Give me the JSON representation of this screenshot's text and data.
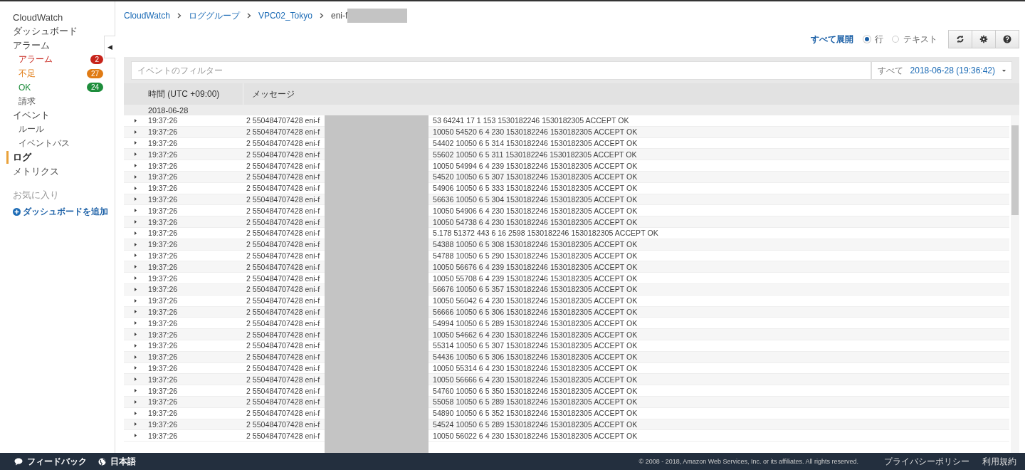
{
  "sidebar": {
    "items": [
      {
        "kind": "section",
        "label": "CloudWatch",
        "selected": false
      },
      {
        "kind": "section",
        "label": "ダッシュボード",
        "selected": false
      },
      {
        "kind": "section",
        "label": "アラーム",
        "selected": false
      },
      {
        "kind": "sub",
        "label": "アラーム",
        "selected": false,
        "badge": "2",
        "color": "#c7241b"
      },
      {
        "kind": "sub",
        "label": "不足",
        "selected": false,
        "badge": "27",
        "color": "#e07b14"
      },
      {
        "kind": "sub",
        "label": "OK",
        "selected": false,
        "badge": "24",
        "color": "#1e8d3c"
      },
      {
        "kind": "sub",
        "label": "請求",
        "selected": false
      },
      {
        "kind": "section",
        "label": "イベント",
        "selected": false
      },
      {
        "kind": "sub",
        "label": "ルール",
        "selected": false
      },
      {
        "kind": "sub",
        "label": "イベントバス",
        "selected": false
      },
      {
        "kind": "section",
        "label": "ログ",
        "selected": true
      },
      {
        "kind": "section",
        "label": "メトリクス",
        "selected": false
      },
      {
        "kind": "heading",
        "label": "お気に入り",
        "selected": false
      },
      {
        "kind": "link",
        "label": "ダッシュボードを追加",
        "selected": false
      }
    ],
    "collapse": "◀"
  },
  "breadcrumb": [
    "CloudWatch",
    "ロググループ",
    "VPC02_Tokyo",
    "eni-f"
  ],
  "toolbar": {
    "expand_all": "すべて展開",
    "view": [
      {
        "label": "行",
        "selected": true
      },
      {
        "label": "テキスト",
        "selected": false
      }
    ]
  },
  "filter": {
    "placeholder": "イベントのフィルター",
    "range_label": "すべて",
    "range_value": "2018-06-28 (19:36:42)"
  },
  "table": {
    "columns": [
      "時間 (UTC +09:00)",
      "メッセージ"
    ],
    "date": "2018-06-28",
    "rows": [
      {
        "time": "19:37:26",
        "message_start": "2 550484707428 eni-f",
        "message_end": "53 64241 17 1 153 1530182246 1530182305 ACCEPT OK"
      },
      {
        "time": "19:37:26",
        "message_start": "2 550484707428 eni-f",
        "message_end": "10050 54520 6 4 230 1530182246 1530182305 ACCEPT OK"
      },
      {
        "time": "19:37:26",
        "message_start": "2 550484707428 eni-f",
        "message_end": "54402 10050 6 5 314 1530182246 1530182305 ACCEPT OK"
      },
      {
        "time": "19:37:26",
        "message_start": "2 550484707428 eni-f",
        "message_end": "55602 10050 6 5 311 1530182246 1530182305 ACCEPT OK"
      },
      {
        "time": "19:37:26",
        "message_start": "2 550484707428 eni-f",
        "message_end": "10050 54994 6 4 239 1530182246 1530182305 ACCEPT OK"
      },
      {
        "time": "19:37:26",
        "message_start": "2 550484707428 eni-f",
        "message_end": "54520 10050 6 5 307 1530182246 1530182305 ACCEPT OK"
      },
      {
        "time": "19:37:26",
        "message_start": "2 550484707428 eni-f",
        "message_end": "54906 10050 6 5 333 1530182246 1530182305 ACCEPT OK"
      },
      {
        "time": "19:37:26",
        "message_start": "2 550484707428 eni-f",
        "message_end": "56636 10050 6 5 304 1530182246 1530182305 ACCEPT OK"
      },
      {
        "time": "19:37:26",
        "message_start": "2 550484707428 eni-f",
        "message_end": "10050 54906 6 4 230 1530182246 1530182305 ACCEPT OK"
      },
      {
        "time": "19:37:26",
        "message_start": "2 550484707428 eni-f",
        "message_end": "10050 54738 6 4 230 1530182246 1530182305 ACCEPT OK"
      },
      {
        "time": "19:37:26",
        "message_start": "2 550484707428 eni-f",
        "message_end": "5.178 51372 443 6 16 2598 1530182246 1530182305 ACCEPT OK"
      },
      {
        "time": "19:37:26",
        "message_start": "2 550484707428 eni-f",
        "message_end": "54388 10050 6 5 308 1530182246 1530182305 ACCEPT OK"
      },
      {
        "time": "19:37:26",
        "message_start": "2 550484707428 eni-f",
        "message_end": "54788 10050 6 5 290 1530182246 1530182305 ACCEPT OK"
      },
      {
        "time": "19:37:26",
        "message_start": "2 550484707428 eni-f",
        "message_end": "10050 56676 6 4 239 1530182246 1530182305 ACCEPT OK"
      },
      {
        "time": "19:37:26",
        "message_start": "2 550484707428 eni-f",
        "message_end": "10050 55708 6 4 239 1530182246 1530182305 ACCEPT OK"
      },
      {
        "time": "19:37:26",
        "message_start": "2 550484707428 eni-f",
        "message_end": "56676 10050 6 5 357 1530182246 1530182305 ACCEPT OK"
      },
      {
        "time": "19:37:26",
        "message_start": "2 550484707428 eni-f",
        "message_end": "10050 56042 6 4 230 1530182246 1530182305 ACCEPT OK"
      },
      {
        "time": "19:37:26",
        "message_start": "2 550484707428 eni-f",
        "message_end": "56666 10050 6 5 306 1530182246 1530182305 ACCEPT OK"
      },
      {
        "time": "19:37:26",
        "message_start": "2 550484707428 eni-f",
        "message_end": "54994 10050 6 5 289 1530182246 1530182305 ACCEPT OK"
      },
      {
        "time": "19:37:26",
        "message_start": "2 550484707428 eni-f",
        "message_end": "10050 54662 6 4 230 1530182246 1530182305 ACCEPT OK"
      },
      {
        "time": "19:37:26",
        "message_start": "2 550484707428 eni-f",
        "message_end": "55314 10050 6 5 307 1530182246 1530182305 ACCEPT OK"
      },
      {
        "time": "19:37:26",
        "message_start": "2 550484707428 eni-f",
        "message_end": "54436 10050 6 5 306 1530182246 1530182305 ACCEPT OK"
      },
      {
        "time": "19:37:26",
        "message_start": "2 550484707428 eni-f",
        "message_end": "10050 55314 6 4 230 1530182246 1530182305 ACCEPT OK"
      },
      {
        "time": "19:37:26",
        "message_start": "2 550484707428 eni-f",
        "message_end": "10050 56666 6 4 230 1530182246 1530182305 ACCEPT OK"
      },
      {
        "time": "19:37:26",
        "message_start": "2 550484707428 eni-f",
        "message_end": "54760 10050 6 5 350 1530182246 1530182305 ACCEPT OK"
      },
      {
        "time": "19:37:26",
        "message_start": "2 550484707428 eni-f",
        "message_end": "55058 10050 6 5 289 1530182246 1530182305 ACCEPT OK"
      },
      {
        "time": "19:37:26",
        "message_start": "2 550484707428 eni-f",
        "message_end": "54890 10050 6 5 352 1530182246 1530182305 ACCEPT OK"
      },
      {
        "time": "19:37:26",
        "message_start": "2 550484707428 eni-f",
        "message_end": "54524 10050 6 5 289 1530182246 1530182305 ACCEPT OK"
      },
      {
        "time": "19:37:26",
        "message_start": "2 550484707428 eni-f",
        "message_end": "10050 56022 6 4 230 1530182246 1530182305 ACCEPT OK"
      }
    ]
  },
  "footer": {
    "feedback": "フィードバック",
    "language": "日本語",
    "copyright": "© 2008 - 2018, Amazon Web Services, Inc. or its affiliates. All rights reserved.",
    "links": [
      "プライバシーポリシー",
      "利用規約"
    ]
  }
}
